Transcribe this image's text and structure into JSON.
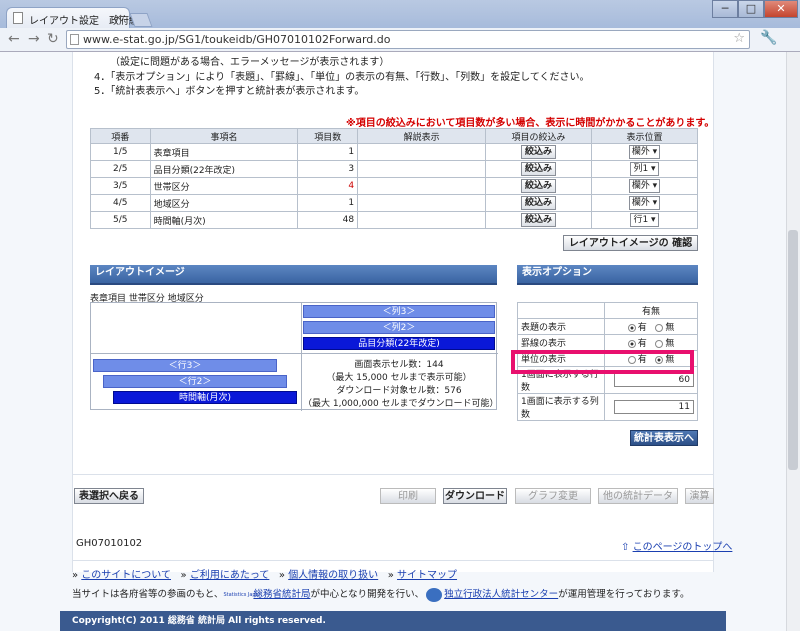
{
  "browser": {
    "tab_title": "レイアウト設定　政府統計",
    "tab_close": "×",
    "url": "www.e-stat.go.jp/SG1/toukeidb/GH07010102Forward.do",
    "window_min": "─",
    "window_max": "□",
    "window_close": "✕"
  },
  "instructions": {
    "line3_tail": "（設定に問題がある場合、エラーメッセージが表示されます）",
    "line4": "4．「表示オプション」により「表題」、「罫線」、「単位」の表示の有無、「行数」、「列数」を設定してください。",
    "line5": "5．「統計表表示へ」ボタンを押すと統計表が表示されます。",
    "warning": "※項目の絞込みにおいて項目数が多い場合、表示に時間がかかることがあります。"
  },
  "items_table": {
    "headers": [
      "項番",
      "事項名",
      "項目数",
      "解説表示",
      "項目の絞込み",
      "表示位置"
    ],
    "rows": [
      {
        "no": "1/5",
        "name": "表章項目",
        "count": "1",
        "filter": "絞込み",
        "pos": "欄外 ▾"
      },
      {
        "no": "2/5",
        "name": "品目分類(22年改定)",
        "count": "3",
        "filter": "絞込み",
        "pos": "列1 ▾"
      },
      {
        "no": "3/5",
        "name": "世帯区分",
        "count": "4",
        "filter": "絞込み",
        "pos": "欄外 ▾"
      },
      {
        "no": "4/5",
        "name": "地域区分",
        "count": "1",
        "filter": "絞込み",
        "pos": "欄外 ▾"
      },
      {
        "no": "5/5",
        "name": "時間軸(月次)",
        "count": "48",
        "filter": "絞込み",
        "pos": "行1 ▾"
      }
    ],
    "confirm_button": "レイアウトイメージの 確認"
  },
  "layout_image": {
    "heading": "レイアウトイメージ",
    "outside_items": "表章項目 世帯区分 地域区分",
    "col3": "＜列3＞",
    "col2": "＜列2＞",
    "col1": "品目分類(22年改定)",
    "row3": "＜行3＞",
    "row2": "＜行2＞",
    "row1": "時間軸(月次)",
    "cells_display": "画面表示セル数：144",
    "cells_display_max": "（最大 15,000 セルまで表示可能）",
    "cells_download": "ダウンロード対象セル数：576",
    "cells_download_max": "（最大 1,000,000 セルまでダウンロード可能）"
  },
  "display_options": {
    "heading": "表示オプション",
    "col_header": "有無",
    "rows": [
      {
        "label": "表題の表示",
        "yes": "有",
        "no": "無",
        "selected": "yes"
      },
      {
        "label": "罫線の表示",
        "yes": "有",
        "no": "無",
        "selected": "yes"
      },
      {
        "label": "単位の表示",
        "yes": "有",
        "no": "無",
        "selected": "no"
      }
    ],
    "rows_per_screen_label": "1画面に表示する行数",
    "rows_per_screen": "60",
    "cols_per_screen_label": "1画面に表示する列数",
    "cols_per_screen": "11",
    "show_table_button": "統計表表示へ"
  },
  "action_bar": {
    "back": "表選択へ戻る",
    "print": "印刷",
    "download": "ダウンロード",
    "graph": "グラフ変更",
    "other": "他の統計データ",
    "calc": "演算"
  },
  "footer": {
    "page_id": "GH07010102",
    "to_top": "このページのトップへ",
    "links": [
      "このサイトについて",
      "ご利用にあたって",
      "個人情報の取り扱い",
      "サイトマップ"
    ],
    "credit_pre": "当サイトは各府省等の参画のもと、",
    "credit_link1": "総務省統計局",
    "credit_mid": "が中心となり開発を行い、",
    "credit_link2": "独立行政法人統計センター",
    "credit_post": "が運用管理を行っております。",
    "stat_japan_label": "Statistics Japan",
    "copyright": "Copyright(C) 2011 総務省 統計局 All rights reserved."
  },
  "colors": {
    "accent": "#3a64a2",
    "highlight": "#e8106e",
    "warning": "#d40000"
  }
}
